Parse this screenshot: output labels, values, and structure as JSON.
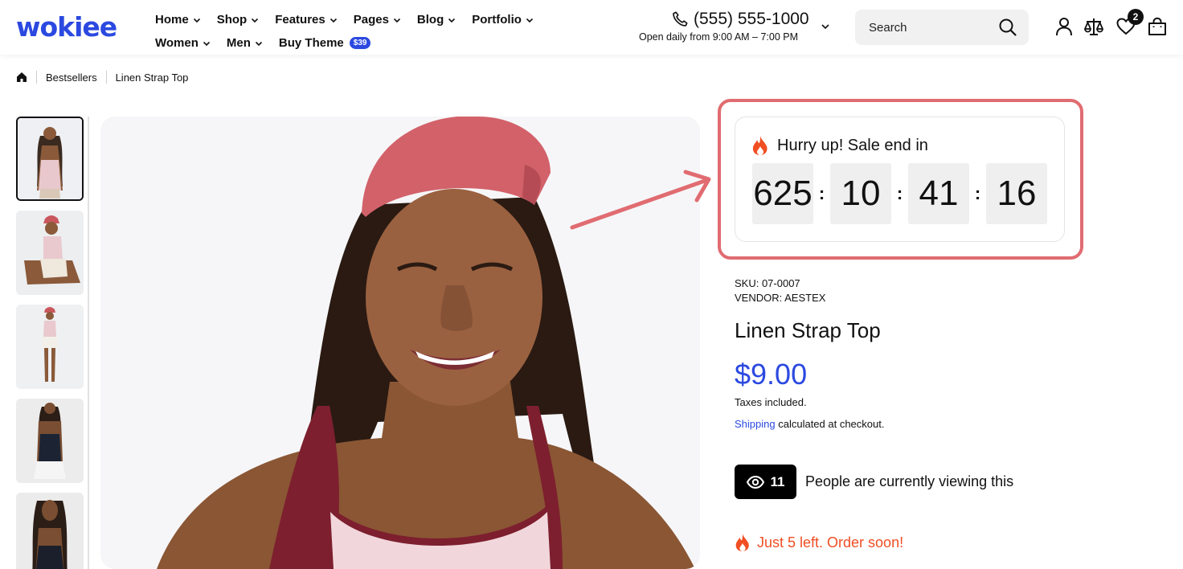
{
  "brand": {
    "logo": "wokiee",
    "accent": "#2b49e0"
  },
  "nav": {
    "row1": [
      "Home",
      "Shop",
      "Features",
      "Pages",
      "Blog",
      "Portfolio"
    ],
    "row2": [
      "Women",
      "Men"
    ],
    "buy_theme": "Buy Theme",
    "buy_theme_badge": "$39"
  },
  "contact": {
    "phone": "(555) 555-1000",
    "hours": "Open daily from 9:00 AM – 7:00 PM"
  },
  "search": {
    "placeholder": "Search"
  },
  "header_icons": [
    "account-icon",
    "compare-icon",
    "wishlist-icon",
    "cart-icon"
  ],
  "wishlist_count": "2",
  "breadcrumb": {
    "items": [
      "Bestsellers",
      "Linen Strap Top"
    ]
  },
  "countdown": {
    "title": "Hurry up! Sale end in",
    "days": "625",
    "hours": "10",
    "minutes": "41",
    "seconds": "16",
    "separator": ":"
  },
  "product": {
    "sku": "SKU: 07-0007",
    "vendor": "VENDOR: AESTEX",
    "title": "Linen Strap Top",
    "price": "$9.00",
    "tax_note": "Taxes included.",
    "shipping_link": "Shipping",
    "shipping_note": " calculated at checkout.",
    "viewers_count": "11",
    "viewers_text": "People are currently viewing this",
    "stock_text": "Just 5 left. Order soon!",
    "stock_color": "#f04e23"
  },
  "annotation_color": "#e06c71"
}
